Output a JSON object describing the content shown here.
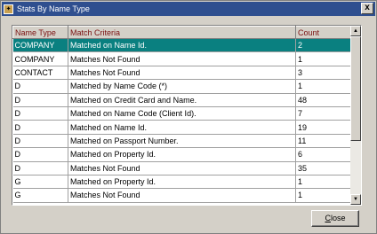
{
  "window": {
    "title": "Stats By Name Type",
    "close_glyph": "x"
  },
  "table": {
    "columns": [
      "Name Type",
      "Match Criteria",
      "Count"
    ],
    "selected_row": 0,
    "rows": [
      {
        "name_type": "COMPANY",
        "criteria": "Matched on Name Id.",
        "count": "2"
      },
      {
        "name_type": "COMPANY",
        "criteria": "Matches Not Found",
        "count": "1"
      },
      {
        "name_type": "CONTACT",
        "criteria": "Matches Not Found",
        "count": "3"
      },
      {
        "name_type": "D",
        "criteria": "Matched by Name Code (*)",
        "count": "1"
      },
      {
        "name_type": "D",
        "criteria": "Matched on Credit Card and Name.",
        "count": "48"
      },
      {
        "name_type": "D",
        "criteria": "Matched on Name Code (Client Id).",
        "count": "7"
      },
      {
        "name_type": "D",
        "criteria": "Matched on Name Id.",
        "count": "19"
      },
      {
        "name_type": "D",
        "criteria": "Matched on Passport Number.",
        "count": "11"
      },
      {
        "name_type": "D",
        "criteria": "Matched on Property Id.",
        "count": "6"
      },
      {
        "name_type": "D",
        "criteria": "Matches Not Found",
        "count": "35"
      },
      {
        "name_type": "G",
        "criteria": "Matched on Property Id.",
        "count": "1"
      },
      {
        "name_type": "G",
        "criteria": "Matches Not Found",
        "count": "1"
      }
    ]
  },
  "buttons": {
    "close_first": "C",
    "close_rest": "lose"
  },
  "colors": {
    "selection": "#0a8080",
    "header_text": "#7a1010",
    "titlebar": "#2f4f8f"
  }
}
